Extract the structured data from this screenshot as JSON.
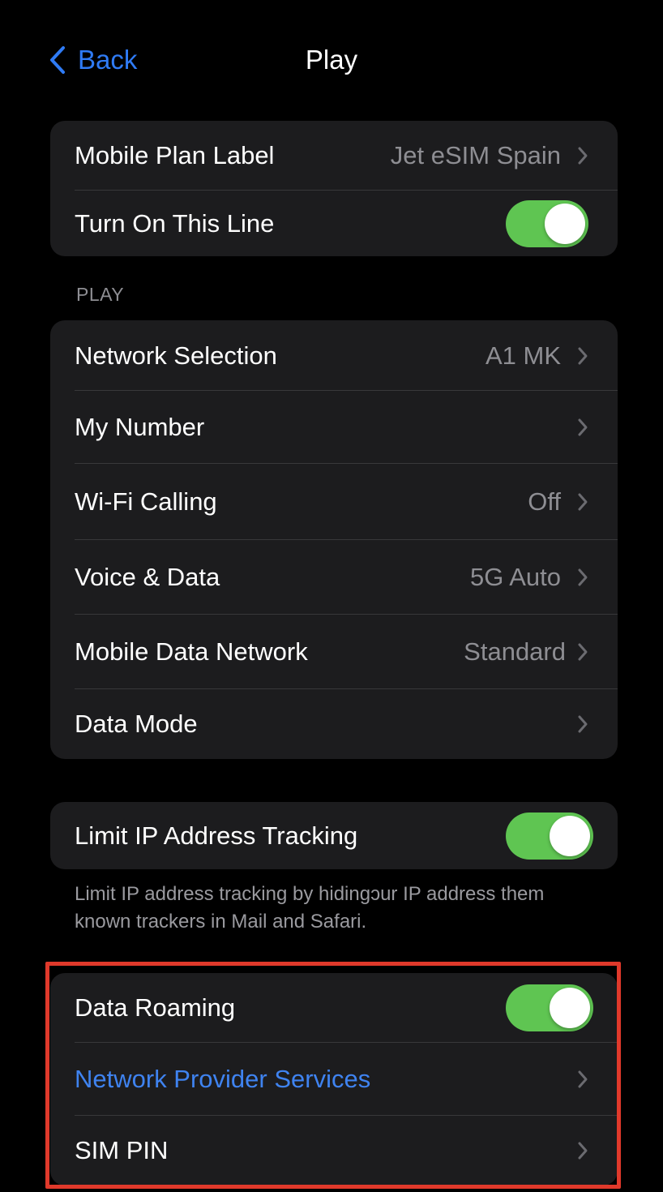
{
  "nav": {
    "back_label": "Back",
    "title": "Play"
  },
  "group1": {
    "plan_label": "Mobile Plan Label",
    "plan_value": "Jet eSIM Spain",
    "line_label": "Turn On This Line",
    "line_on": true
  },
  "section_header": "PLAY",
  "group2": {
    "items": [
      {
        "label": "Network Selection",
        "value": "A1 MK"
      },
      {
        "label": "My Number",
        "value": ""
      },
      {
        "label": "Wi-Fi Calling",
        "value": "Off"
      },
      {
        "label": "Voice & Data",
        "value": "5G Auto"
      },
      {
        "label": "Mobile Data Network",
        "value": "Standard"
      },
      {
        "label": "Data Mode",
        "value": ""
      }
    ]
  },
  "group3": {
    "label": "Limit IP Address Tracking",
    "on": true,
    "footer": "Limit IP address tracking by hidingɔur IP address them known trackers in Mail and Safari."
  },
  "group4": {
    "roaming_label": "Data Roaming",
    "roaming_on": true,
    "provider_label": "Network Provider Services",
    "simpin_label": "SIM PIN"
  },
  "colors": {
    "accent": "#2f7bf5",
    "toggle_on": "#5fc552",
    "highlight_border": "#e0392b",
    "cell_bg": "#1c1c1e"
  }
}
